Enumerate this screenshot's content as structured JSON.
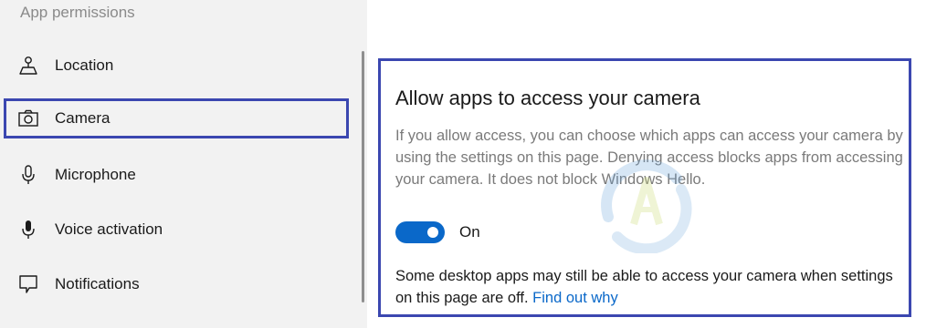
{
  "sidebar": {
    "heading": "App permissions",
    "items": [
      {
        "label": "Location",
        "icon": "location-pin-icon"
      },
      {
        "label": "Camera",
        "icon": "camera-icon",
        "selected": true
      },
      {
        "label": "Microphone",
        "icon": "microphone-icon"
      },
      {
        "label": "Voice activation",
        "icon": "voice-activation-icon"
      },
      {
        "label": "Notifications",
        "icon": "notification-bubble-icon"
      }
    ]
  },
  "main": {
    "title": "Allow apps to access your camera",
    "description": "If you allow access, you can choose which apps can access your camera by using the settings on this page. Denying access blocks apps from accessing your camera. It does not block Windows Hello.",
    "toggle": {
      "state": "On",
      "on": true
    },
    "note": "Some desktop apps may still be able to access your camera when settings on this page are off.",
    "link": "Find out why"
  },
  "colors": {
    "accent": "#0a68c9",
    "highlight_border": "#3b47b0",
    "sidebar_bg": "#f2f2f2"
  }
}
